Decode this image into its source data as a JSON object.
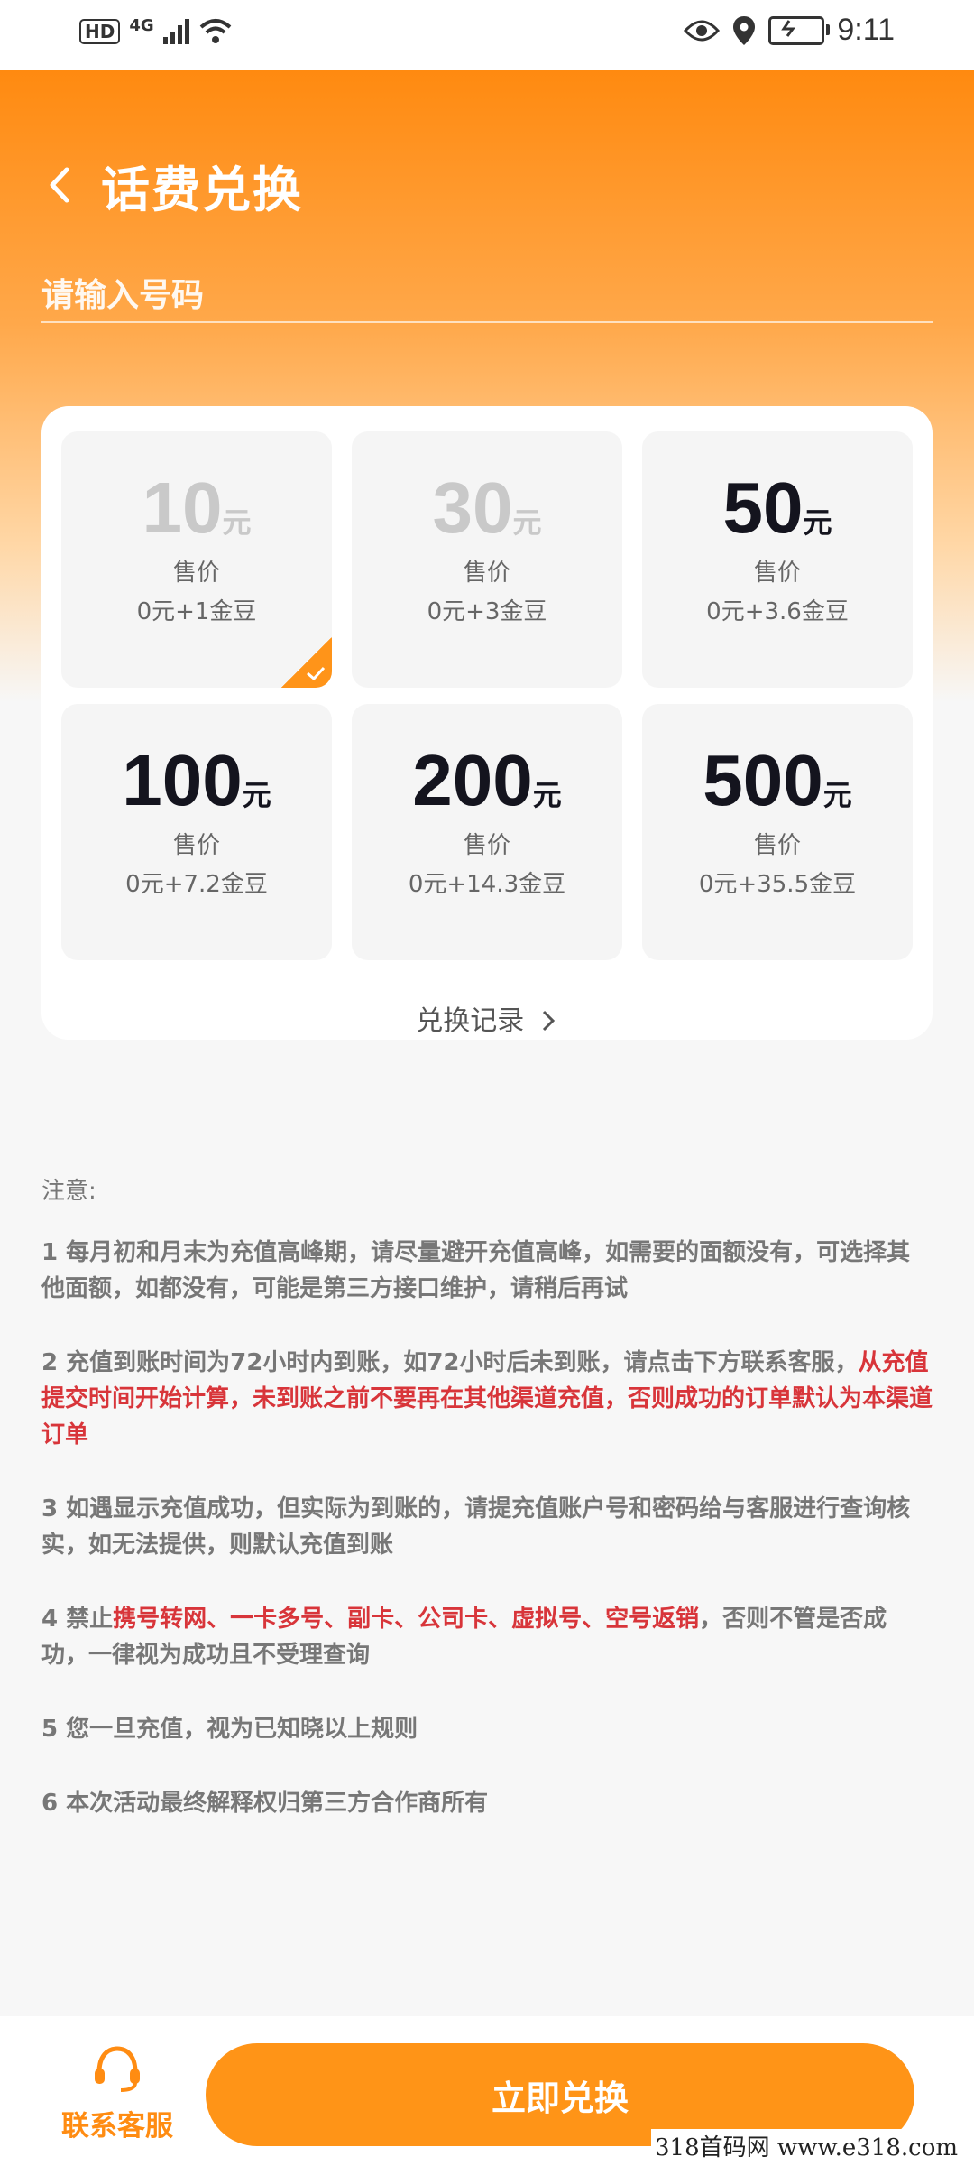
{
  "status_bar": {
    "hd": "HD",
    "network": "4G",
    "time": "9:11"
  },
  "header": {
    "title": "话费兑换"
  },
  "phone_input": {
    "placeholder": "请输入号码"
  },
  "denominations": [
    {
      "amount": "10",
      "unit": "元",
      "sale_label": "售价",
      "price": "0元+1金豆",
      "disabled": true,
      "selected": true
    },
    {
      "amount": "30",
      "unit": "元",
      "sale_label": "售价",
      "price": "0元+3金豆",
      "disabled": true,
      "selected": false
    },
    {
      "amount": "50",
      "unit": "元",
      "sale_label": "售价",
      "price": "0元+3.6金豆",
      "disabled": false,
      "selected": false
    },
    {
      "amount": "100",
      "unit": "元",
      "sale_label": "售价",
      "price": "0元+7.2金豆",
      "disabled": false,
      "selected": false
    },
    {
      "amount": "200",
      "unit": "元",
      "sale_label": "售价",
      "price": "0元+14.3金豆",
      "disabled": false,
      "selected": false
    },
    {
      "amount": "500",
      "unit": "元",
      "sale_label": "售价",
      "price": "0元+35.5金豆",
      "disabled": false,
      "selected": false
    }
  ],
  "history_link": "兑换记录",
  "notes": {
    "title": "注意:",
    "items": [
      {
        "parts": [
          {
            "text": "1 每月初和月末为充值高峰期，请尽量避开充值高峰，如需要的面额没有，可选择其他面额，如都没有，可能是第三方接口维护，请稍后再试",
            "red": false
          }
        ]
      },
      {
        "parts": [
          {
            "text": "2 充值到账时间为72小时内到账，如72小时后未到账，请点击下方联系客服，",
            "red": false
          },
          {
            "text": "从充值提交时间开始计算，未到账之前不要再在其他渠道充值，否则成功的订单默认为本渠道订单",
            "red": true
          }
        ]
      },
      {
        "parts": [
          {
            "text": "3 如遇显示充值成功，但实际为到账的，请提充值账户号和密码给与客服进行查询核实，如无法提供，则默认充值到账",
            "red": false
          }
        ]
      },
      {
        "parts": [
          {
            "text": "4 禁止",
            "red": false
          },
          {
            "text": "携号转网、一卡多号、副卡、公司卡、虚拟号、空号返销",
            "red": true
          },
          {
            "text": "，否则不管是否成功，一律视为成功且不受理查询",
            "red": false
          }
        ]
      },
      {
        "parts": [
          {
            "text": "5 您一旦充值，视为已知晓以上规则",
            "red": false
          }
        ]
      },
      {
        "parts": [
          {
            "text": "6 本次活动最终解释权归第三方合作商所有",
            "red": false
          }
        ]
      }
    ]
  },
  "bottom_bar": {
    "customer_service_label": "联系客服",
    "exchange_button": "立即兑换"
  },
  "watermark": "318首码网  www.e318.com",
  "colors": {
    "accent": "#ff9417",
    "warning_red": "#d8353a",
    "text_dark": "#14141e"
  }
}
